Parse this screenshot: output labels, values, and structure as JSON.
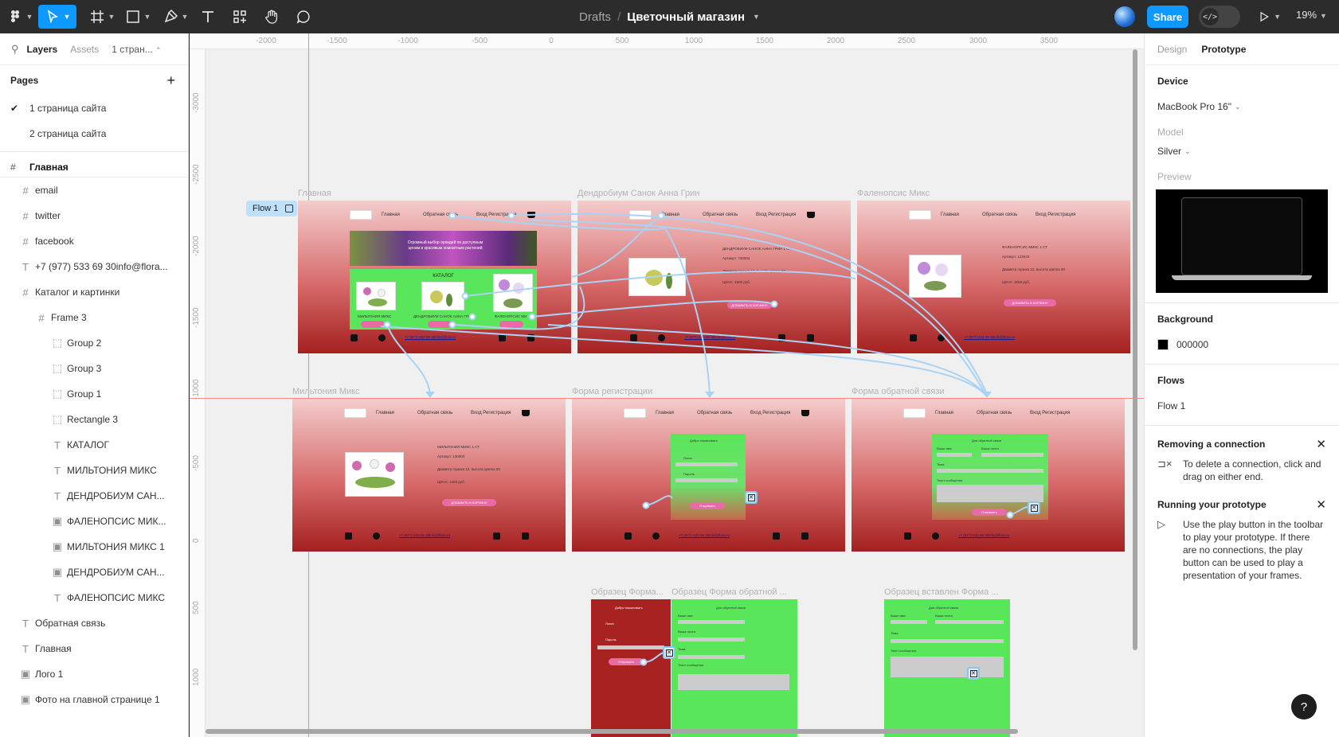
{
  "toolbar": {
    "project": "Drafts",
    "separator": "/",
    "file_name": "Цветочный магазин",
    "share_label": "Share",
    "zoom": "19%"
  },
  "left_panel": {
    "tabs": [
      "Layers",
      "Assets"
    ],
    "page_selector": "1 стран...",
    "pages_title": "Pages",
    "pages": [
      {
        "label": "1 страница сайта",
        "selected": true
      },
      {
        "label": "2 страница сайта",
        "selected": false
      }
    ],
    "current_frame": "Главная",
    "layers": [
      {
        "label": "email",
        "type": "frame"
      },
      {
        "label": "twitter",
        "type": "frame"
      },
      {
        "label": "facebook",
        "type": "frame"
      },
      {
        "label": "+7 (977) 533 69 30info@flora...",
        "type": "text"
      },
      {
        "label": "Каталог и картинки",
        "type": "frame"
      },
      {
        "label": "Frame 3",
        "type": "frame"
      },
      {
        "label": "Group 2",
        "type": "group"
      },
      {
        "label": "Group 3",
        "type": "group"
      },
      {
        "label": "Group 1",
        "type": "group"
      },
      {
        "label": "Rectangle 3",
        "type": "rect"
      },
      {
        "label": "КАТАЛОГ",
        "type": "text"
      },
      {
        "label": "МИЛЬТОНИЯ МИКС",
        "type": "text"
      },
      {
        "label": "ДЕНДРОБИУМ САН...",
        "type": "text"
      },
      {
        "label": "ФАЛЕНОПСИС МИК...",
        "type": "image"
      },
      {
        "label": "МИЛЬТОНИЯ МИКС 1",
        "type": "image"
      },
      {
        "label": "ДЕНДРОБИУМ САН...",
        "type": "image"
      },
      {
        "label": "ФАЛЕНОПСИС МИКС",
        "type": "text"
      },
      {
        "label": "Обратная связь",
        "type": "text"
      },
      {
        "label": "Главная",
        "type": "text"
      },
      {
        "label": "Лого 1",
        "type": "image"
      },
      {
        "label": "Фото на главной странице 1",
        "type": "image"
      }
    ]
  },
  "canvas": {
    "ruler_top": [
      "-2000",
      "-1500",
      "-1000",
      "-500",
      "0",
      "500",
      "1000",
      "1500",
      "2000",
      "2500",
      "3000",
      "3500"
    ],
    "ruler_left": [
      "-3000",
      "-2500",
      "-2000",
      "-1500",
      "-1000",
      "-500",
      "0",
      "500",
      "1000"
    ],
    "flow_badge": "Flow 1",
    "frames": [
      {
        "label": "Главная"
      },
      {
        "label": "Дендробиум Санок Анна Грин"
      },
      {
        "label": "Фаленопсис Микс"
      },
      {
        "label": "Мильтония Микс"
      },
      {
        "label": "Форма регистрации"
      },
      {
        "label": "Форма обратной связи"
      },
      {
        "label": "Образец Форма..."
      },
      {
        "label": "Образец Форма обратной ..."
      },
      {
        "label": "Образец вставлен Форма ..."
      }
    ],
    "nav": {
      "home": "Главная",
      "feedback": "Обратная связь",
      "login": "Вход Регистрация"
    },
    "hero_text": "Огромный выбор орхидей по доступным ценам и красивым комнатным растений",
    "catalog_title": "КАТАЛОГ",
    "catalog_items": [
      "МИЛЬТОНИЯ МИКС",
      "ДЕНДРОБИУМ САНОК АННА ГРИ",
      "ФАЛЕНОПСИС МИ"
    ],
    "add_to_cart": "ДОБАВИТЬ В КОРЗИНУ",
    "send": "Отправить",
    "footer_contact": "+7 (977) 533 69 30info@flora.ru",
    "products": {
      "dendrobium": {
        "name": "ДЕНДРОБИУМ САНОК АННА ГРИН 1 СТ",
        "sku": "Артикул: 730003",
        "size": "Диаметр горшка 12, высота цветка 50",
        "price": "ЦЕНА: 2500 руб."
      },
      "phalaenopsis": {
        "name": "ФАЛЕНОПСИС МИКС 1 СТ",
        "sku": "Артикул: 123045",
        "size": "Диаметр горшка 12, высота цветка 60",
        "price": "ЦЕНА: 3050 руб."
      },
      "miltonia": {
        "name": "МИЛЬТОНИЯ МИКС 1 СТ",
        "sku": "Артикул: 130003",
        "size": "Диаметр горшка 12, высота цветка 60",
        "price": "ЦЕНА: 1450 руб."
      }
    },
    "reg_form": {
      "title": "Добро пожаловать",
      "login": "Логин",
      "password": "Пароль"
    },
    "feedback_form": {
      "title": "Для обратной связи",
      "name": "Ваше имя",
      "mail": "Ваша почта",
      "theme": "Тема",
      "message": "Текст сообщения"
    }
  },
  "right_panel": {
    "tabs": [
      "Design",
      "Prototype"
    ],
    "device_title": "Device",
    "device_value": "MacBook Pro 16\"",
    "model_label": "Model",
    "model_value": "Silver",
    "preview_label": "Preview",
    "background_title": "Background",
    "background_hex": "000000",
    "flows_title": "Flows",
    "flows": [
      "Flow 1"
    ],
    "tips": [
      {
        "title": "Removing a connection",
        "body": "To delete a connection, click and drag on either end."
      },
      {
        "title": "Running your prototype",
        "body": "Use the play button in the toolbar to play your prototype. If there are no connections, the play button can be used to play a presentation of your frames."
      }
    ],
    "help": "?"
  },
  "colors": {
    "accent": "#0d99ff",
    "frame_gradient_top": "#f4cccc",
    "frame_gradient_bottom": "#a42020",
    "catalog_green": "#5ae65a",
    "connector": "#a9d3f5",
    "guide": "#f28a80"
  }
}
